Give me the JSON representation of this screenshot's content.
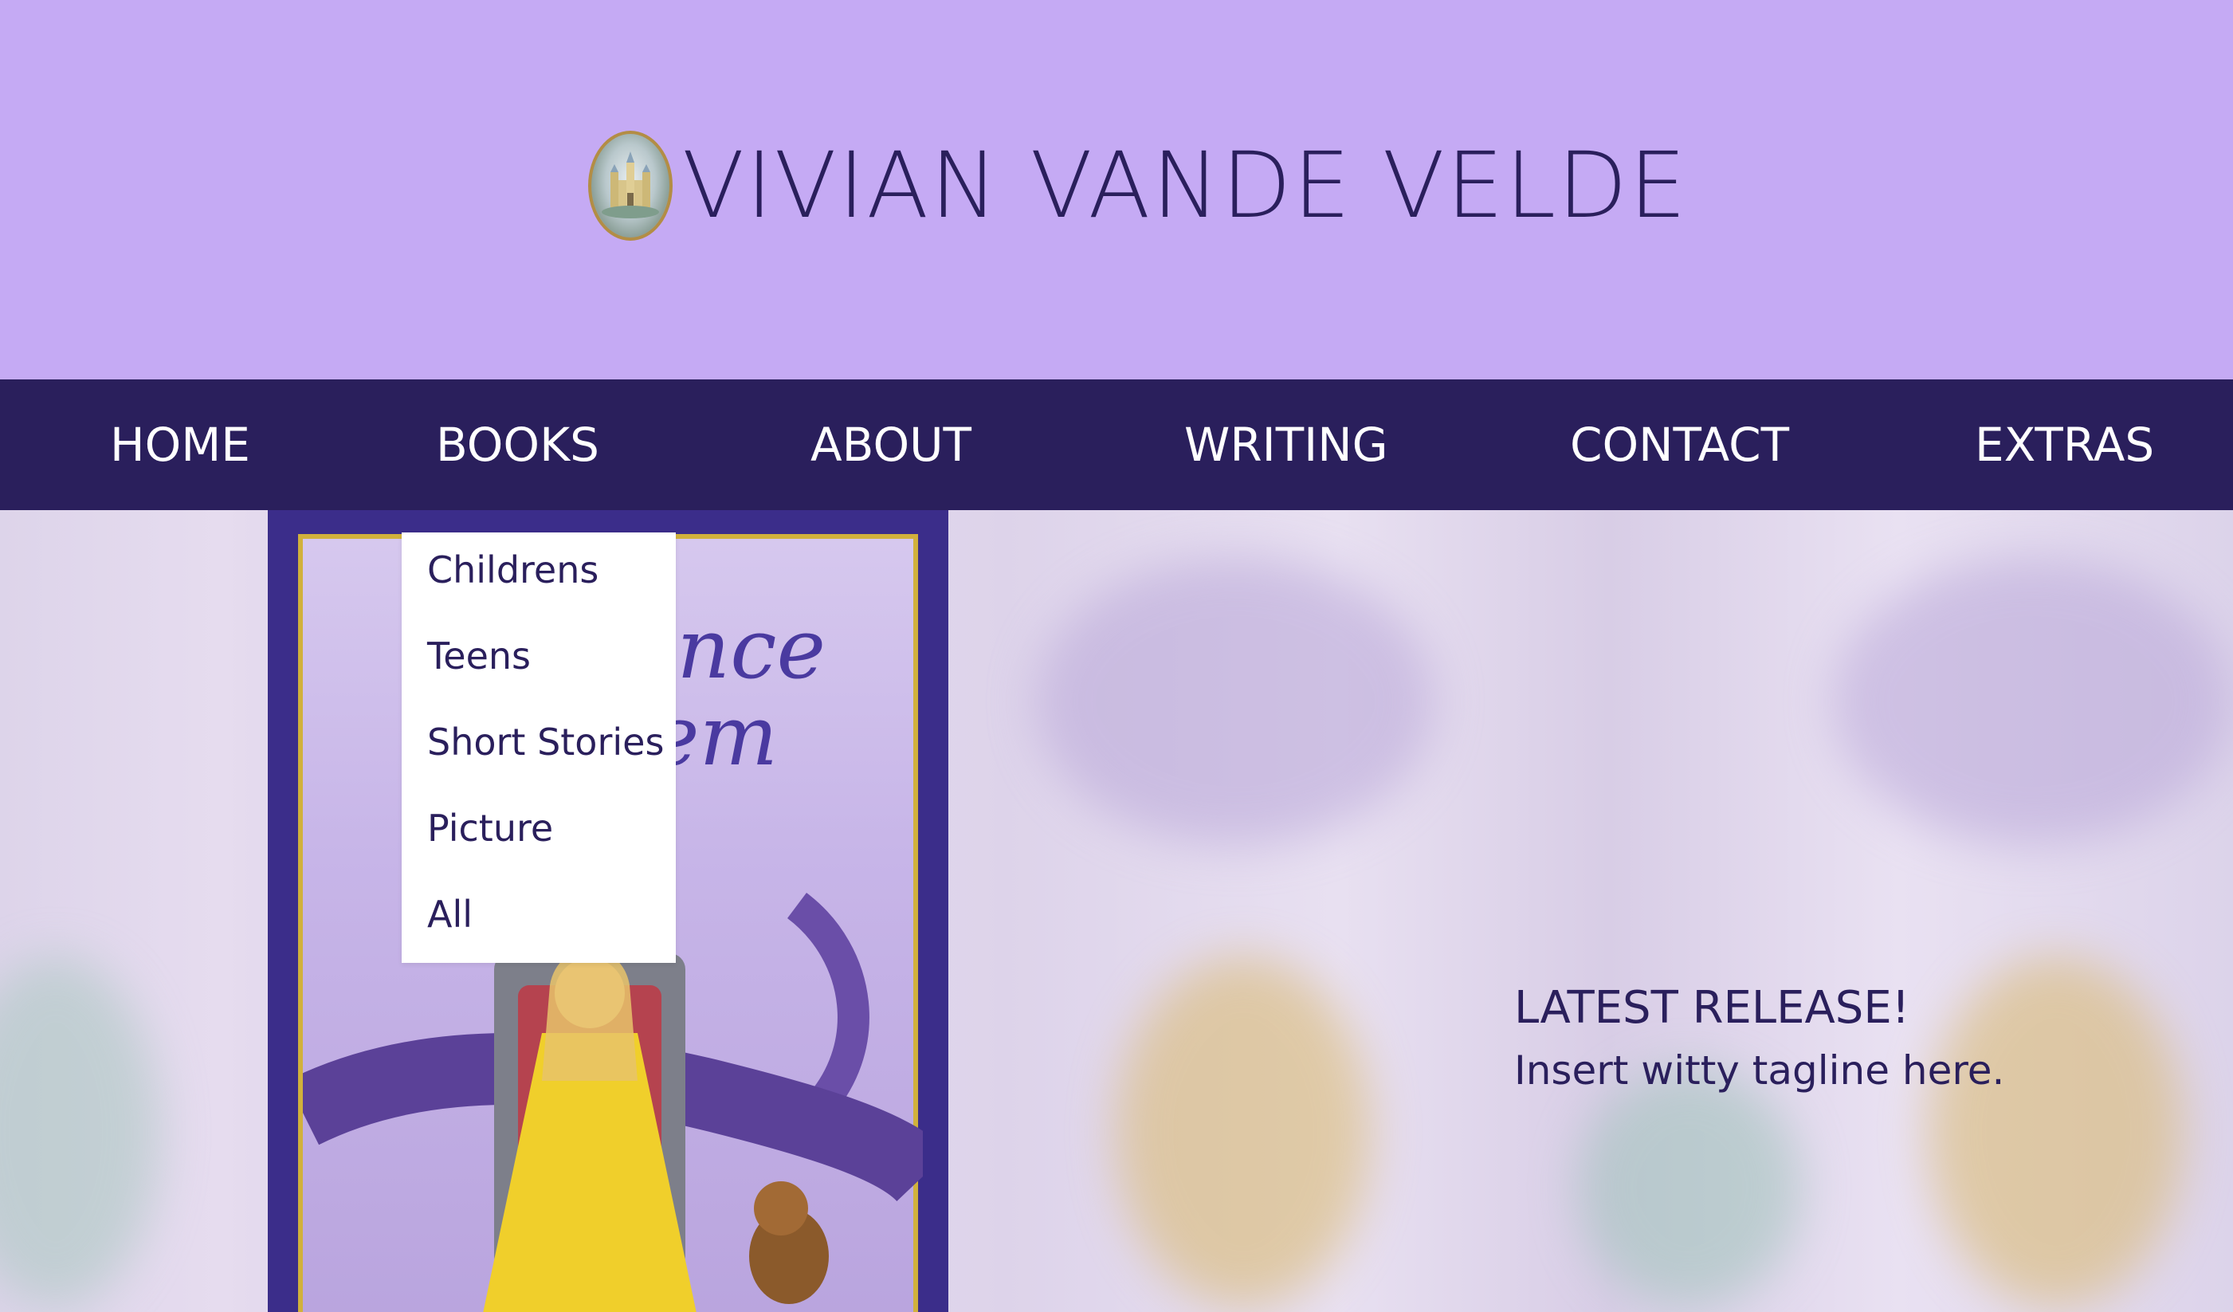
{
  "header": {
    "site_title": "VIVIAN VANDE VELDE",
    "logo_icon": "castle-medallion-icon",
    "background_color": "#c5aaf4",
    "title_color": "#2a1f5c"
  },
  "nav": {
    "background_color": "#2a1f5c",
    "items": [
      {
        "label": "HOME"
      },
      {
        "label": "BOOKS"
      },
      {
        "label": "ABOUT"
      },
      {
        "label": "WRITING"
      },
      {
        "label": "CONTACT"
      },
      {
        "label": "EXTRAS"
      }
    ]
  },
  "books_dropdown": {
    "items": [
      {
        "label": "Childrens"
      },
      {
        "label": "Teens"
      },
      {
        "label": "Short Stories"
      },
      {
        "label": "Picture"
      },
      {
        "label": "All"
      }
    ]
  },
  "hero": {
    "cover_title_visible": "ince\nem",
    "release_heading": "LATEST RELEASE!",
    "release_tagline": "Insert witty tagline here."
  }
}
